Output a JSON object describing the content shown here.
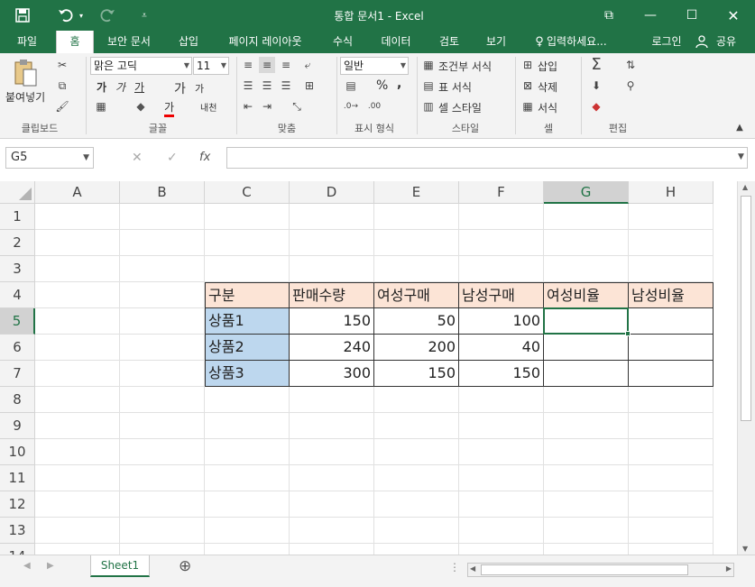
{
  "titlebar": {
    "title": "통합 문서1 - Excel",
    "save_icon": "save-icon",
    "undo_icon": "undo-icon",
    "redo_icon": "redo-icon",
    "minimize": "—",
    "maximize": "☐",
    "close": "✕",
    "restore": "⧉"
  },
  "tabs": {
    "file": "파일",
    "home": "홈",
    "security": "보안 문서",
    "insert": "삽입",
    "layout": "페이지 레이아웃",
    "formulas": "수식",
    "data": "데이터",
    "review": "검토",
    "view": "보기",
    "tellme": "입력하세요...",
    "signin": "로그인",
    "share": "공유"
  },
  "ribbon": {
    "paste": "붙여넣기",
    "clipboard_group": "클립보드",
    "font_name": "맑은 고딕",
    "font_size": "11",
    "font_group": "글꼴",
    "align_group": "맞춤",
    "number_format": "일반",
    "number_group": "표시 형식",
    "cond_format": "조건부 서식",
    "table_format": "표 서식",
    "cell_style": "셀 스타일",
    "style_group": "스타일",
    "insert": "삽입",
    "delete": "삭제",
    "format": "서식",
    "cells_group": "셀",
    "edit_group": "편집",
    "bold": "가",
    "italic": "가",
    "underline": "가",
    "grow": "가",
    "shrink": "가",
    "fontcolor": "가",
    "phonetic": "내천",
    "percent": "%",
    "comma": ","
  },
  "formula_bar": {
    "name_box": "G5",
    "cancel": "✕",
    "enter": "✓",
    "fx": "fx",
    "content": ""
  },
  "columns": [
    "A",
    "B",
    "C",
    "D",
    "E",
    "F",
    "G",
    "H"
  ],
  "rows": [
    "1",
    "2",
    "3",
    "4",
    "5",
    "6",
    "7",
    "8",
    "9",
    "10",
    "11",
    "12",
    "13",
    "14"
  ],
  "selected_cell": "G5",
  "table": {
    "header": [
      "구분",
      "판매수량",
      "여성구매",
      "남성구매",
      "여성비율",
      "남성비율"
    ],
    "rows": [
      [
        "상품1",
        "150",
        "50",
        "100",
        "",
        ""
      ],
      [
        "상품2",
        "240",
        "200",
        "40",
        "",
        ""
      ],
      [
        "상품3",
        "300",
        "150",
        "150",
        "",
        ""
      ]
    ]
  },
  "colors": {
    "excel_green": "#217346",
    "header_fill": "#fce4d6",
    "item_fill": "#bdd7ee"
  },
  "sheets": [
    "Sheet1"
  ],
  "sheetbar": {
    "add": "⊕"
  }
}
